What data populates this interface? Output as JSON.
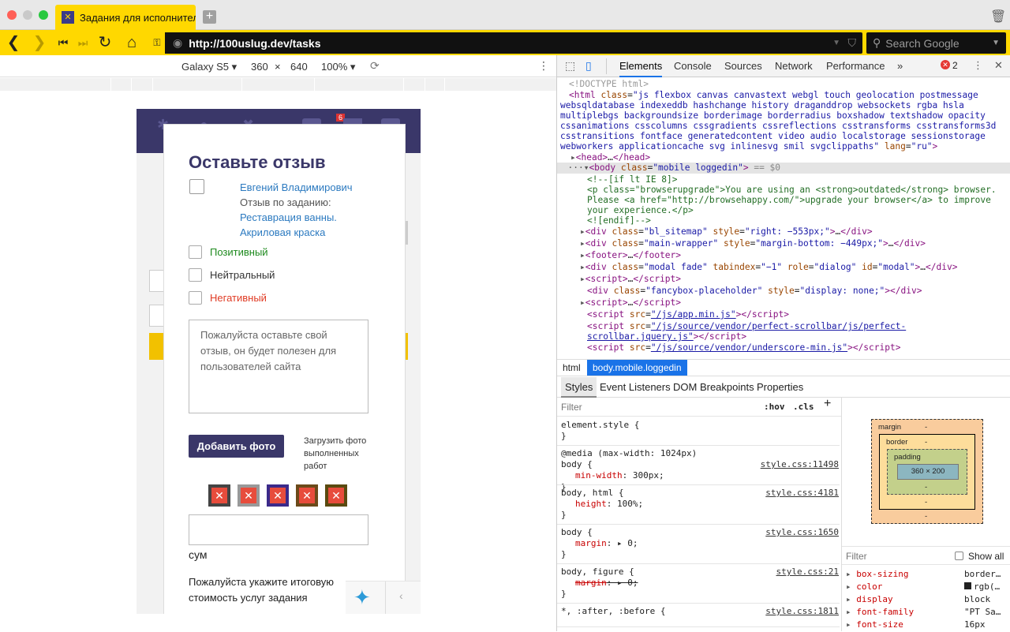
{
  "browser": {
    "tab_title": "Задания для исполнителей",
    "url": "http://100uslug.dev/tasks",
    "search_placeholder": "Search Google"
  },
  "device_toolbar": {
    "device": "Galaxy S5",
    "width": "360",
    "x_sep": "×",
    "height": "640",
    "zoom": "100%"
  },
  "page": {
    "modal_title": "Оставьте отзыв",
    "user_name": "Евгений Владимирович",
    "task_prefix": "Отзыв по заданию:",
    "task_name": "Реставрация ванны. Акриловая краска",
    "options": [
      {
        "label": "Позитивный",
        "color": "#1e8a1e"
      },
      {
        "label": "Нейтральный",
        "color": "#333333"
      },
      {
        "label": "Негативный",
        "color": "#e03b24"
      }
    ],
    "textarea_placeholder": "Пожалуйста оставьте свой отзыв, он будет полезен для пользователей сайта",
    "add_photo_button": "Добавить фото",
    "upload_hint": "Загрузить фото выполненных работ",
    "currency_label": "сум",
    "total_hint": "Пожалуйста укажите итоговую стоимость услуг задания",
    "notification_count": "6",
    "accent": "#3a3769"
  },
  "devtools": {
    "tabs": [
      "Elements",
      "Console",
      "Sources",
      "Network",
      "Performance",
      "»"
    ],
    "error_count": "2",
    "breadcrumb": [
      "html",
      "body.mobile.loggedin"
    ],
    "style_tabs": [
      "Styles",
      "Event Listeners",
      "DOM Breakpoints",
      "Properties"
    ],
    "filter_placeholder": "Filter",
    "hov": ":hov",
    "cls": ".cls",
    "box_model": {
      "margin": "margin",
      "border": "border",
      "padding": "padding",
      "content": "360 × 200",
      "dash": "-"
    },
    "computed_filter": "Filter",
    "show_all": "Show all",
    "computed": [
      {
        "name": "box-sizing",
        "value": "border…"
      },
      {
        "name": "color",
        "value": "rgb(…"
      },
      {
        "name": "display",
        "value": "block"
      },
      {
        "name": "font-family",
        "value": "\"PT Sa…"
      },
      {
        "name": "font-size",
        "value": "16px"
      }
    ],
    "rules": [
      {
        "selector": "element.style {",
        "source": "",
        "decls": []
      },
      {
        "selector": "@media (max-width: 1024px)\nbody {",
        "source": "style.css:11498",
        "decls": [
          "min-width: 300px;"
        ]
      },
      {
        "selector": "body, html {",
        "source": "style.css:4181",
        "decls": [
          "height: 100%;"
        ]
      },
      {
        "selector": "body {",
        "source": "style.css:1650",
        "decls": [
          "margin: ▸ 0;"
        ]
      },
      {
        "selector": "body, figure {",
        "source": "style.css:21",
        "decls": [
          "margin: ▸ 0;"
        ]
      },
      {
        "selector": "*, :after, :before {",
        "source": "style.css:1811",
        "decls": []
      }
    ]
  }
}
